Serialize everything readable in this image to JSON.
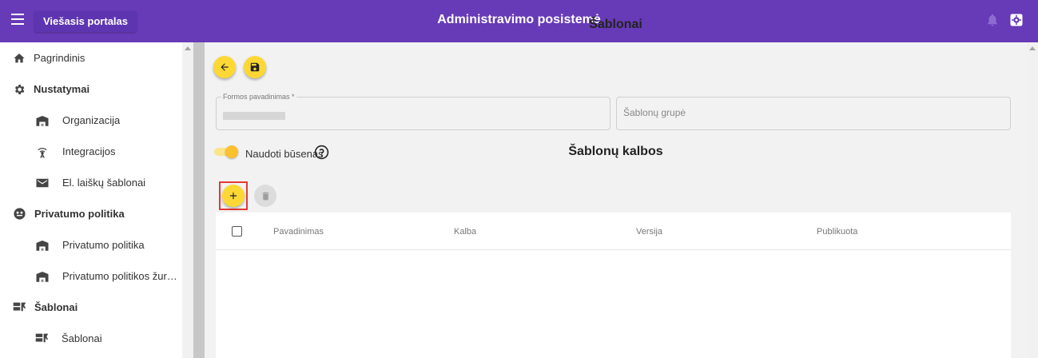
{
  "header": {
    "portal_button": "Viešasis portalas",
    "title": "Administravimo posistemė",
    "icons": [
      "menu-icon",
      "bell-icon",
      "settings-icon"
    ],
    "color": "#673ab7"
  },
  "sidebar": {
    "items": [
      {
        "label": "Pagrindinis",
        "icon": "home-icon",
        "level": "top"
      },
      {
        "label": "Nustatymai",
        "icon": "gear-icon",
        "level": "section"
      },
      {
        "label": "Organizacija",
        "icon": "building-icon",
        "level": "sub"
      },
      {
        "label": "Integracijos",
        "icon": "antenna-icon",
        "level": "sub"
      },
      {
        "label": "El. laiškų šablonai",
        "icon": "mail-icon",
        "level": "sub"
      },
      {
        "label": "Privatumo politika",
        "icon": "privacy-icon",
        "level": "section"
      },
      {
        "label": "Privatumo politika",
        "icon": "building-icon",
        "level": "sub"
      },
      {
        "label": "Privatumo politikos žurnalas",
        "icon": "building-icon",
        "level": "sub"
      },
      {
        "label": "Šablonai",
        "icon": "template-icon",
        "level": "section"
      },
      {
        "label": "Šablonai",
        "icon": "template-icon",
        "level": "sub"
      }
    ]
  },
  "main": {
    "page_title": "Šablonai",
    "form": {
      "name_label": "Formos pavadinimas *",
      "group_placeholder": "Šablonų grupė"
    },
    "toggle": {
      "label": "Naudoti būsenas",
      "on": true
    },
    "languages": {
      "title": "Šablonų kalbos",
      "columns": [
        "Pavadinimas",
        "Kalba",
        "Versija",
        "Publikuota"
      ],
      "rows": []
    },
    "accent_color": "#fdd835"
  }
}
